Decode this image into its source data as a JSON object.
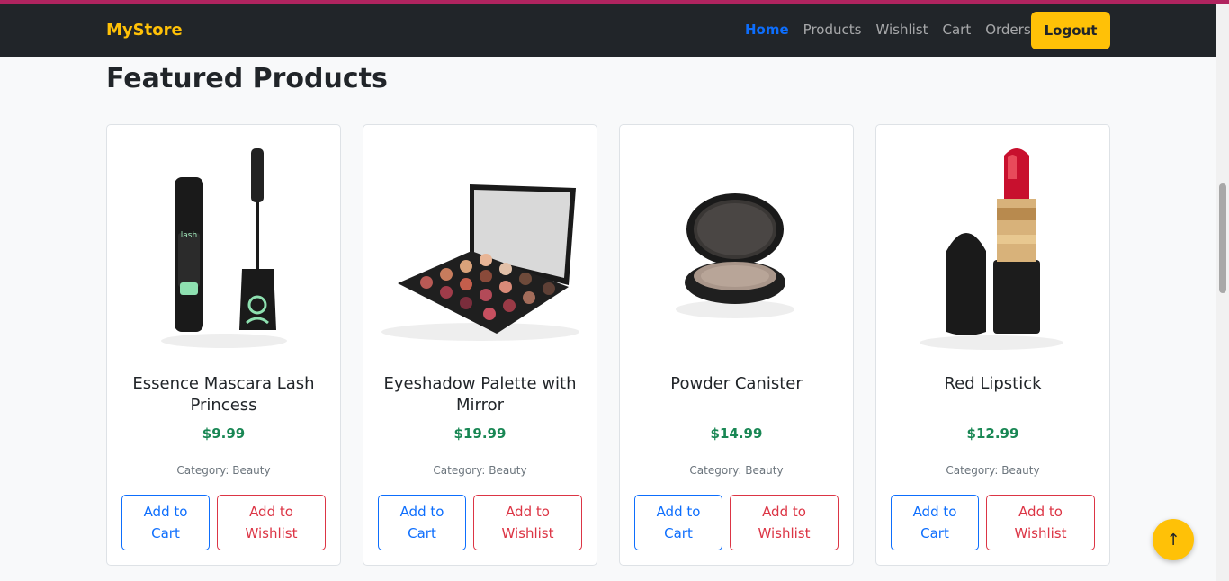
{
  "nav": {
    "brand": "MyStore",
    "links": [
      {
        "label": "Home",
        "active": true
      },
      {
        "label": "Products"
      },
      {
        "label": "Wishlist"
      },
      {
        "label": "Cart"
      },
      {
        "label": "Orders"
      }
    ],
    "logout_label": "Logout"
  },
  "main": {
    "title": "Featured Products",
    "products": [
      {
        "name": "Essence Mascara Lash Princess",
        "price": "$9.99",
        "category": "Category: Beauty",
        "add_cart": "Add to Cart",
        "add_wishlist": "Add to Wishlist",
        "image": "mascara-image"
      },
      {
        "name": "Eyeshadow Palette with Mirror",
        "price": "$19.99",
        "category": "Category: Beauty",
        "add_cart": "Add to Cart",
        "add_wishlist": "Add to Wishlist",
        "image": "eyeshadow-palette-image"
      },
      {
        "name": "Powder Canister",
        "price": "$14.99",
        "category": "Category: Beauty",
        "add_cart": "Add to Cart",
        "add_wishlist": "Add to Wishlist",
        "image": "powder-canister-image"
      },
      {
        "name": "Red Lipstick",
        "price": "$12.99",
        "category": "Category: Beauty",
        "add_cart": "Add to Cart",
        "add_wishlist": "Add to Wishlist",
        "image": "lipstick-image"
      }
    ]
  },
  "scroll_top": {
    "icon": "arrow-up-icon",
    "glyph": "↑"
  },
  "colors": {
    "brand": "#ffc107",
    "navbar": "#212529",
    "primary": "#0d6efd",
    "danger": "#dc3545",
    "price": "#198754"
  }
}
